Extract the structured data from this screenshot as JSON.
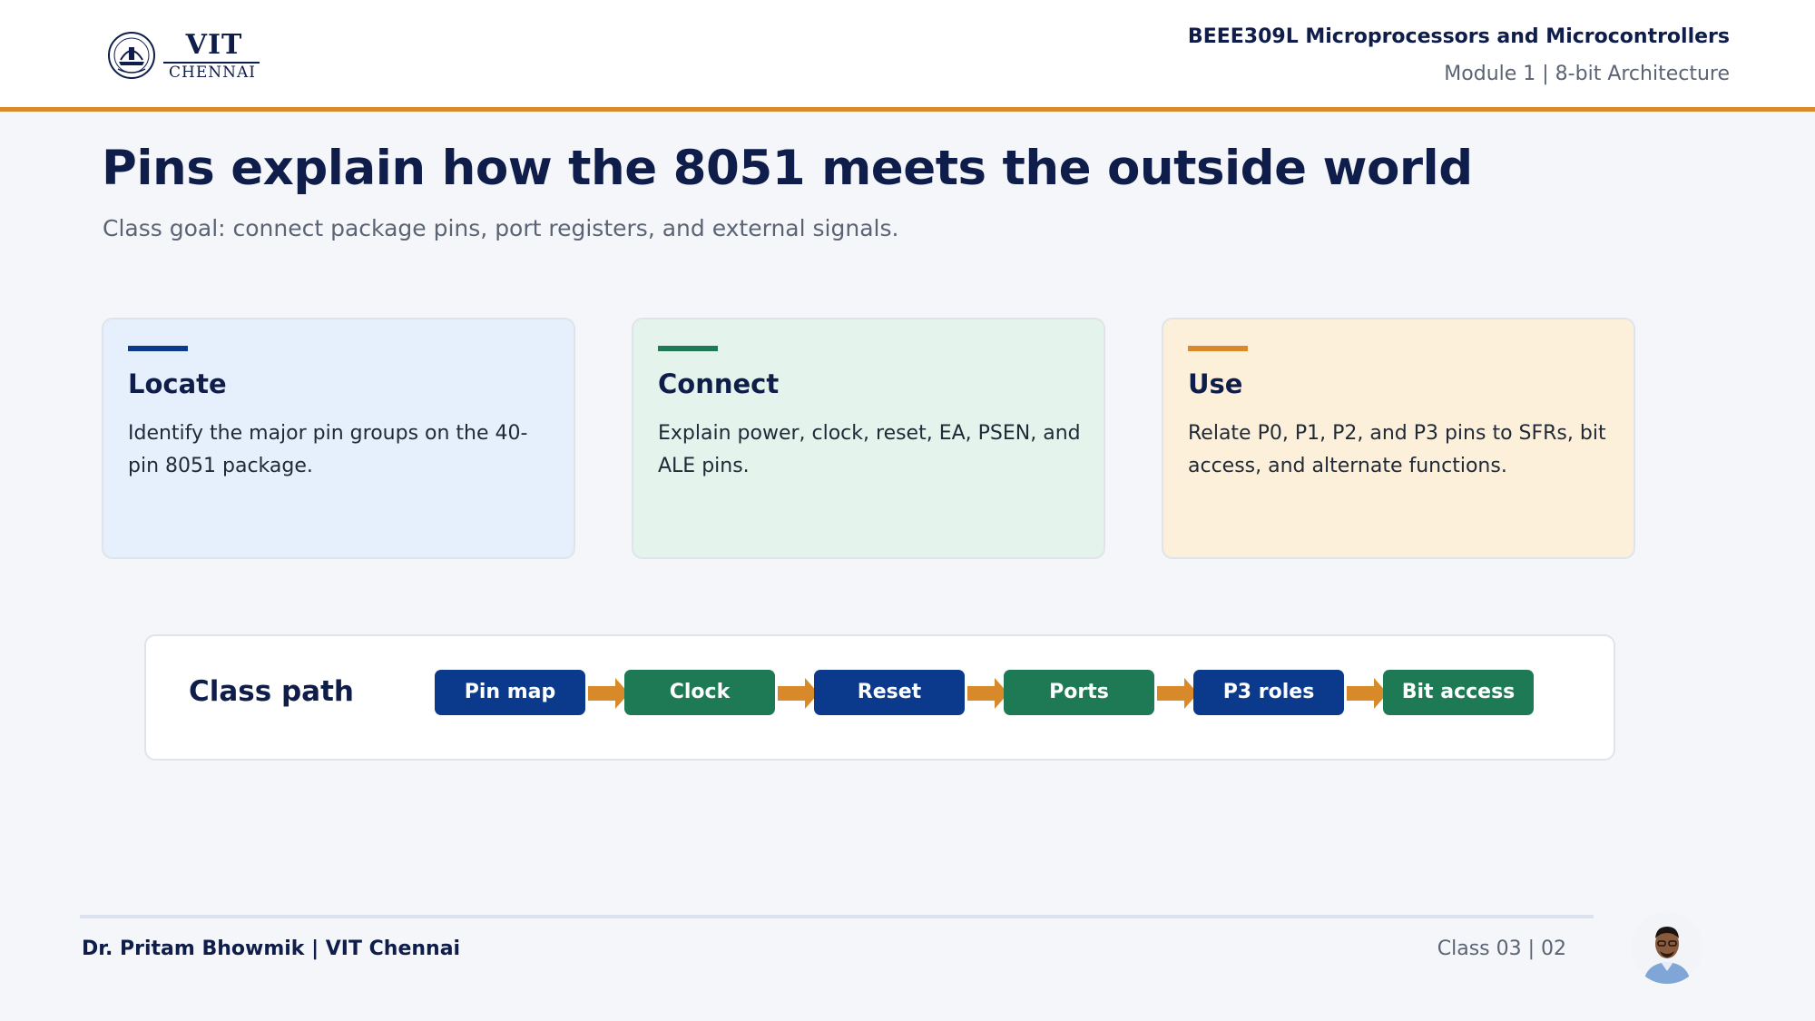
{
  "header": {
    "logo": {
      "name": "VIT",
      "city": "CHENNAI"
    },
    "course_title": "BEEE309L Microprocessors and Microcontrollers",
    "module_title": "Module 1 | 8-bit Architecture"
  },
  "slide": {
    "title": "Pins explain how the 8051 meets the outside world",
    "subtitle": "Class goal: connect package pins, port registers, and external signals."
  },
  "cards": [
    {
      "title": "Locate",
      "body": "Identify the major pin groups on the 40-pin 8051 package.",
      "bg": "#e6effc",
      "accent": "#0b3a8c"
    },
    {
      "title": "Connect",
      "body": "Explain power, clock, reset, EA, PSEN, and ALE pins.",
      "bg": "#e4f3ec",
      "accent": "#1e7a55"
    },
    {
      "title": "Use",
      "body": "Relate P0, P1, P2, and P3 pins to SFRs, bit access, and alternate functions.",
      "bg": "#fdf0db",
      "accent": "#d8892a"
    }
  ],
  "class_path": {
    "label": "Class path",
    "steps": [
      {
        "label": "Pin map",
        "color": "#0b3a8c"
      },
      {
        "label": "Clock",
        "color": "#1e7a55"
      },
      {
        "label": "Reset",
        "color": "#0b3a8c"
      },
      {
        "label": "Ports",
        "color": "#1e7a55"
      },
      {
        "label": "P3 roles",
        "color": "#0b3a8c"
      },
      {
        "label": "Bit access",
        "color": "#1e7a55"
      }
    ],
    "arrow_color": "#d8892a"
  },
  "footer": {
    "author": "Dr. Pritam Bhowmik | VIT Chennai",
    "class_page": "Class 03  |  02"
  },
  "colors": {
    "navy": "#0f1d4a",
    "accent_orange": "#d8892a",
    "muted": "#5b6475"
  }
}
